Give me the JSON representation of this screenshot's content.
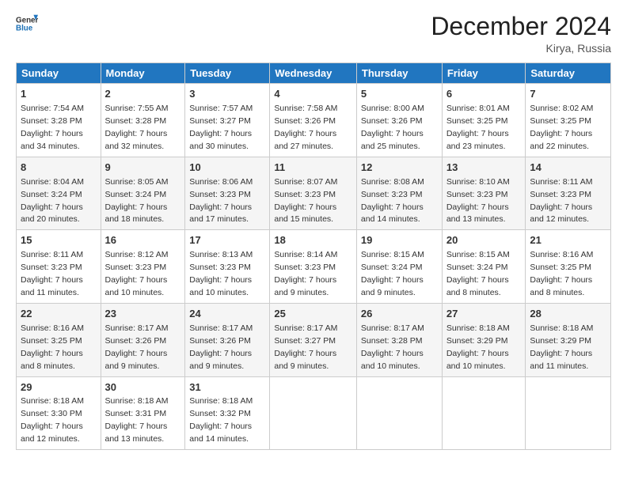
{
  "header": {
    "logo_line1": "General",
    "logo_line2": "Blue",
    "month": "December 2024",
    "location": "Kirya, Russia"
  },
  "weekdays": [
    "Sunday",
    "Monday",
    "Tuesday",
    "Wednesday",
    "Thursday",
    "Friday",
    "Saturday"
  ],
  "weeks": [
    [
      {
        "day": "1",
        "sunrise": "7:54 AM",
        "sunset": "3:28 PM",
        "daylight": "7 hours and 34 minutes."
      },
      {
        "day": "2",
        "sunrise": "7:55 AM",
        "sunset": "3:28 PM",
        "daylight": "7 hours and 32 minutes."
      },
      {
        "day": "3",
        "sunrise": "7:57 AM",
        "sunset": "3:27 PM",
        "daylight": "7 hours and 30 minutes."
      },
      {
        "day": "4",
        "sunrise": "7:58 AM",
        "sunset": "3:26 PM",
        "daylight": "7 hours and 27 minutes."
      },
      {
        "day": "5",
        "sunrise": "8:00 AM",
        "sunset": "3:26 PM",
        "daylight": "7 hours and 25 minutes."
      },
      {
        "day": "6",
        "sunrise": "8:01 AM",
        "sunset": "3:25 PM",
        "daylight": "7 hours and 23 minutes."
      },
      {
        "day": "7",
        "sunrise": "8:02 AM",
        "sunset": "3:25 PM",
        "daylight": "7 hours and 22 minutes."
      }
    ],
    [
      {
        "day": "8",
        "sunrise": "8:04 AM",
        "sunset": "3:24 PM",
        "daylight": "7 hours and 20 minutes."
      },
      {
        "day": "9",
        "sunrise": "8:05 AM",
        "sunset": "3:24 PM",
        "daylight": "7 hours and 18 minutes."
      },
      {
        "day": "10",
        "sunrise": "8:06 AM",
        "sunset": "3:23 PM",
        "daylight": "7 hours and 17 minutes."
      },
      {
        "day": "11",
        "sunrise": "8:07 AM",
        "sunset": "3:23 PM",
        "daylight": "7 hours and 15 minutes."
      },
      {
        "day": "12",
        "sunrise": "8:08 AM",
        "sunset": "3:23 PM",
        "daylight": "7 hours and 14 minutes."
      },
      {
        "day": "13",
        "sunrise": "8:10 AM",
        "sunset": "3:23 PM",
        "daylight": "7 hours and 13 minutes."
      },
      {
        "day": "14",
        "sunrise": "8:11 AM",
        "sunset": "3:23 PM",
        "daylight": "7 hours and 12 minutes."
      }
    ],
    [
      {
        "day": "15",
        "sunrise": "8:11 AM",
        "sunset": "3:23 PM",
        "daylight": "7 hours and 11 minutes."
      },
      {
        "day": "16",
        "sunrise": "8:12 AM",
        "sunset": "3:23 PM",
        "daylight": "7 hours and 10 minutes."
      },
      {
        "day": "17",
        "sunrise": "8:13 AM",
        "sunset": "3:23 PM",
        "daylight": "7 hours and 10 minutes."
      },
      {
        "day": "18",
        "sunrise": "8:14 AM",
        "sunset": "3:23 PM",
        "daylight": "7 hours and 9 minutes."
      },
      {
        "day": "19",
        "sunrise": "8:15 AM",
        "sunset": "3:24 PM",
        "daylight": "7 hours and 9 minutes."
      },
      {
        "day": "20",
        "sunrise": "8:15 AM",
        "sunset": "3:24 PM",
        "daylight": "7 hours and 8 minutes."
      },
      {
        "day": "21",
        "sunrise": "8:16 AM",
        "sunset": "3:25 PM",
        "daylight": "7 hours and 8 minutes."
      }
    ],
    [
      {
        "day": "22",
        "sunrise": "8:16 AM",
        "sunset": "3:25 PM",
        "daylight": "7 hours and 8 minutes."
      },
      {
        "day": "23",
        "sunrise": "8:17 AM",
        "sunset": "3:26 PM",
        "daylight": "7 hours and 9 minutes."
      },
      {
        "day": "24",
        "sunrise": "8:17 AM",
        "sunset": "3:26 PM",
        "daylight": "7 hours and 9 minutes."
      },
      {
        "day": "25",
        "sunrise": "8:17 AM",
        "sunset": "3:27 PM",
        "daylight": "7 hours and 9 minutes."
      },
      {
        "day": "26",
        "sunrise": "8:17 AM",
        "sunset": "3:28 PM",
        "daylight": "7 hours and 10 minutes."
      },
      {
        "day": "27",
        "sunrise": "8:18 AM",
        "sunset": "3:29 PM",
        "daylight": "7 hours and 10 minutes."
      },
      {
        "day": "28",
        "sunrise": "8:18 AM",
        "sunset": "3:29 PM",
        "daylight": "7 hours and 11 minutes."
      }
    ],
    [
      {
        "day": "29",
        "sunrise": "8:18 AM",
        "sunset": "3:30 PM",
        "daylight": "7 hours and 12 minutes."
      },
      {
        "day": "30",
        "sunrise": "8:18 AM",
        "sunset": "3:31 PM",
        "daylight": "7 hours and 13 minutes."
      },
      {
        "day": "31",
        "sunrise": "8:18 AM",
        "sunset": "3:32 PM",
        "daylight": "7 hours and 14 minutes."
      },
      null,
      null,
      null,
      null
    ]
  ]
}
